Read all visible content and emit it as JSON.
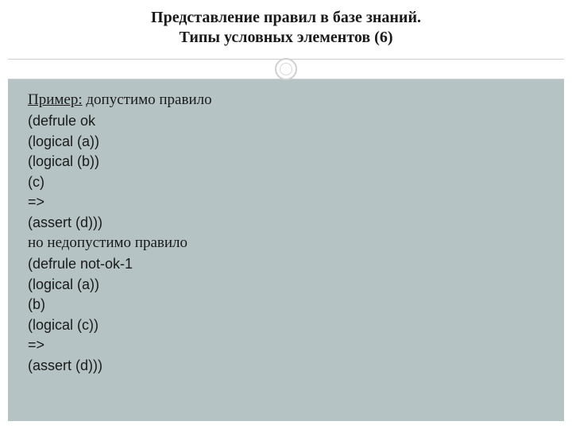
{
  "title": {
    "line1": "Представление правил в базе знаний.",
    "line2": "Типы условных элементов (6)"
  },
  "body": {
    "example_label": "Пример:",
    "example_rest": " допустимо правило",
    "ok_rule": {
      "l1": "(defrule ok",
      "l2": "(logical (a))",
      "l3": "(logical (b))",
      "l4": "(c)",
      "l5": "=>",
      "l6": "(assert (d)))"
    },
    "but_text": "но недопустимо правило",
    "bad_rule": {
      "l1": "(defrule not-ok-1",
      "l2": "(logical (a))",
      "l3": "(b)",
      "l4": "(logical (c))",
      "l5": "=>",
      "l6": "(assert (d)))"
    }
  }
}
